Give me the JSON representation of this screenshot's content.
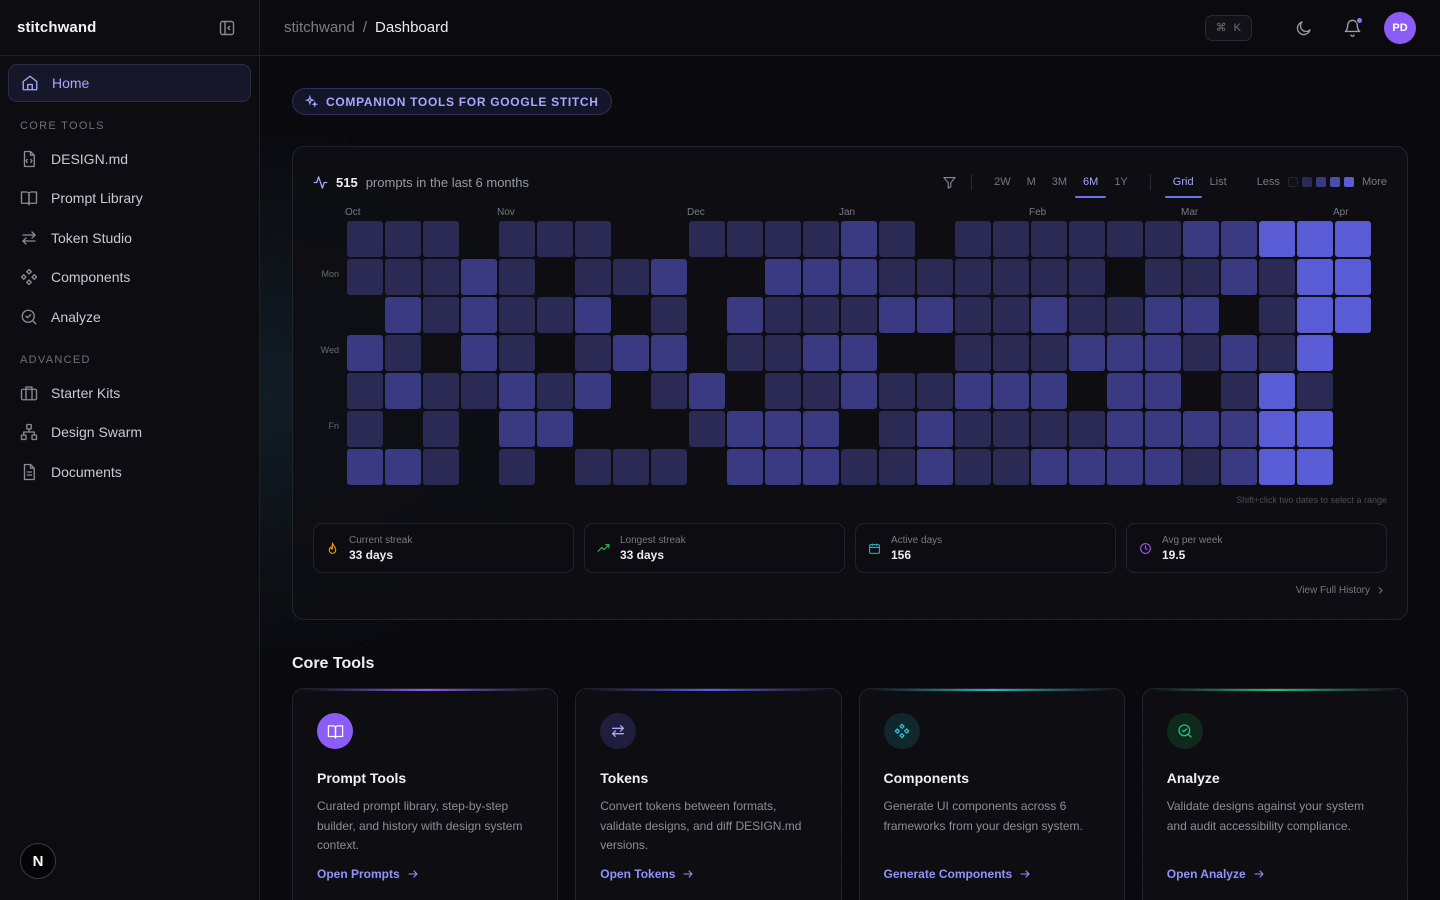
{
  "app": {
    "brand": "stitchwand"
  },
  "sidebar": {
    "home": "Home",
    "sections": [
      {
        "title": "CORE TOOLS",
        "items": [
          "DESIGN.md",
          "Prompt Library",
          "Token Studio",
          "Components",
          "Analyze"
        ]
      },
      {
        "title": "ADVANCED",
        "items": [
          "Starter Kits",
          "Design Swarm",
          "Documents"
        ]
      }
    ],
    "badge": "N"
  },
  "topbar": {
    "crumb_root": "stitchwand",
    "crumb_sep": "/",
    "crumb_current": "Dashboard",
    "shortcut_symbol": "⌘",
    "shortcut_key": "K",
    "avatar_initials": "PD"
  },
  "hero": {
    "pill": "COMPANION TOOLS FOR GOOGLE STITCH"
  },
  "activity": {
    "count": "515",
    "count_suffix": "prompts in the last 6 months",
    "ranges": [
      "2W",
      "M",
      "3M",
      "6M",
      "1Y"
    ],
    "active_range": "6M",
    "views": [
      "Grid",
      "List"
    ],
    "active_view": "Grid",
    "legend_less": "Less",
    "legend_more": "More",
    "months": [
      "Oct",
      "Nov",
      "Dec",
      "Jan",
      "Feb",
      "Mar",
      "Apr"
    ],
    "days": [
      "Mon",
      "Wed",
      "Fri"
    ],
    "hint": "Shift+click two dates to select a range",
    "view_history": "View Full History",
    "stats": [
      {
        "label": "Current streak",
        "value": "33 days"
      },
      {
        "label": "Longest streak",
        "value": "33 days"
      },
      {
        "label": "Active days",
        "value": "156"
      },
      {
        "label": "Avg per week",
        "value": "19.5"
      }
    ],
    "colors": {
      "0": "#121218",
      "1": "#1f1f3a",
      "2": "#2a2a55",
      "3": "#3a3a82",
      "4": "#5a5cd6"
    }
  },
  "core_tools": {
    "title": "Core Tools",
    "cards": [
      {
        "title": "Prompt Tools",
        "desc": "Curated prompt library, step-by-step builder, and history with design system context.",
        "link": "Open Prompts"
      },
      {
        "title": "Tokens",
        "desc": "Convert tokens between formats, validate designs, and diff DESIGN.md versions.",
        "link": "Open Tokens"
      },
      {
        "title": "Components",
        "desc": "Generate UI components across 6 frameworks from your design system.",
        "link": "Generate Components"
      },
      {
        "title": "Analyze",
        "desc": "Validate designs against your system and audit accessibility compliance.",
        "link": "Open Analyze"
      }
    ]
  }
}
